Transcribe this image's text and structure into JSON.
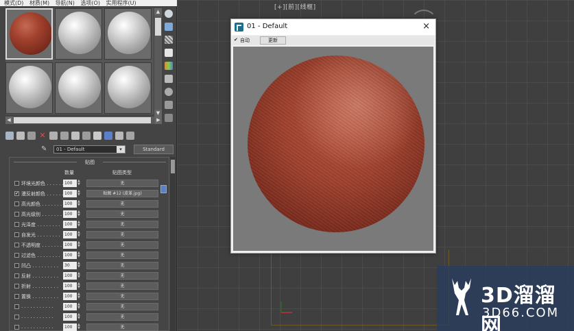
{
  "menubar": [
    "模式(D)",
    "材质(M)",
    "导航(N)",
    "选项(O)",
    "实用程序(U)"
  ],
  "viewport": {
    "label": "[+][前][线框]"
  },
  "material": {
    "name": "01 - Default",
    "type_button": "Standard"
  },
  "maps": {
    "title": "贴图",
    "col_amount": "数量",
    "col_type": "贴图类型",
    "rows": [
      {
        "label": "环境光颜色 . . . . . .",
        "amount": "100",
        "map": "无",
        "checked": false
      },
      {
        "label": "漫反射颜色 . . . . . .",
        "amount": "100",
        "map": "贴图 #12 (皮革.jpg)",
        "checked": true
      },
      {
        "label": "高光颜色 . . . . . . .",
        "amount": "100",
        "map": "无",
        "checked": false
      },
      {
        "label": "高光级别 . . . . . . .",
        "amount": "100",
        "map": "无",
        "checked": false
      },
      {
        "label": "光泽度 . . . . . . . .",
        "amount": "100",
        "map": "无",
        "checked": false
      },
      {
        "label": "自发光 . . . . . . . .",
        "amount": "100",
        "map": "无",
        "checked": false
      },
      {
        "label": "不透明度 . . . . . . .",
        "amount": "100",
        "map": "无",
        "checked": false
      },
      {
        "label": "过滤色 . . . . . . . .",
        "amount": "100",
        "map": "无",
        "checked": false
      },
      {
        "label": "凹凸 . . . . . . . . .",
        "amount": "30",
        "map": "无",
        "checked": false
      },
      {
        "label": "反射 . . . . . . . . .",
        "amount": "100",
        "map": "无",
        "checked": false
      },
      {
        "label": "折射 . . . . . . . . .",
        "amount": "100",
        "map": "无",
        "checked": false
      },
      {
        "label": "置换 . . . . . . . . .",
        "amount": "100",
        "map": "无",
        "checked": false
      },
      {
        "label": ". . . . . . . . . . .",
        "amount": "100",
        "map": "无",
        "checked": false
      },
      {
        "label": ". . . . . . . . . . .",
        "amount": "100",
        "map": "无",
        "checked": false
      },
      {
        "label": ". . . . . . . . . . .",
        "amount": "100",
        "map": "无",
        "checked": false
      }
    ]
  },
  "preview": {
    "title": "01 - Default",
    "close": "×",
    "auto_label": "自动",
    "update_label": "更新"
  },
  "watermark": {
    "line1": "3D溜溜网",
    "line2": "3D66.COM"
  },
  "colors": {
    "leather": "#a0412e",
    "accent": "#5b7fc8"
  }
}
